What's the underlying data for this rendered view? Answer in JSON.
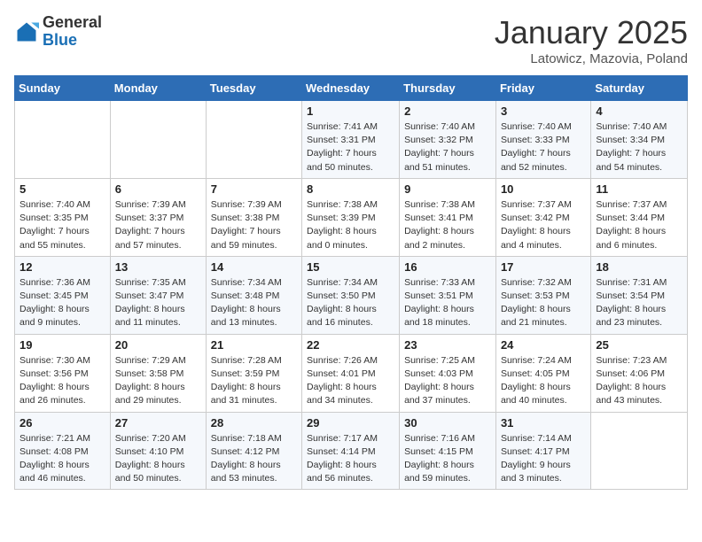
{
  "header": {
    "logo_general": "General",
    "logo_blue": "Blue",
    "title": "January 2025",
    "subtitle": "Latowicz, Mazovia, Poland"
  },
  "days_of_week": [
    "Sunday",
    "Monday",
    "Tuesday",
    "Wednesday",
    "Thursday",
    "Friday",
    "Saturday"
  ],
  "weeks": [
    [
      {
        "day": "",
        "info": ""
      },
      {
        "day": "",
        "info": ""
      },
      {
        "day": "",
        "info": ""
      },
      {
        "day": "1",
        "info": "Sunrise: 7:41 AM\nSunset: 3:31 PM\nDaylight: 7 hours and 50 minutes."
      },
      {
        "day": "2",
        "info": "Sunrise: 7:40 AM\nSunset: 3:32 PM\nDaylight: 7 hours and 51 minutes."
      },
      {
        "day": "3",
        "info": "Sunrise: 7:40 AM\nSunset: 3:33 PM\nDaylight: 7 hours and 52 minutes."
      },
      {
        "day": "4",
        "info": "Sunrise: 7:40 AM\nSunset: 3:34 PM\nDaylight: 7 hours and 54 minutes."
      }
    ],
    [
      {
        "day": "5",
        "info": "Sunrise: 7:40 AM\nSunset: 3:35 PM\nDaylight: 7 hours and 55 minutes."
      },
      {
        "day": "6",
        "info": "Sunrise: 7:39 AM\nSunset: 3:37 PM\nDaylight: 7 hours and 57 minutes."
      },
      {
        "day": "7",
        "info": "Sunrise: 7:39 AM\nSunset: 3:38 PM\nDaylight: 7 hours and 59 minutes."
      },
      {
        "day": "8",
        "info": "Sunrise: 7:38 AM\nSunset: 3:39 PM\nDaylight: 8 hours and 0 minutes."
      },
      {
        "day": "9",
        "info": "Sunrise: 7:38 AM\nSunset: 3:41 PM\nDaylight: 8 hours and 2 minutes."
      },
      {
        "day": "10",
        "info": "Sunrise: 7:37 AM\nSunset: 3:42 PM\nDaylight: 8 hours and 4 minutes."
      },
      {
        "day": "11",
        "info": "Sunrise: 7:37 AM\nSunset: 3:44 PM\nDaylight: 8 hours and 6 minutes."
      }
    ],
    [
      {
        "day": "12",
        "info": "Sunrise: 7:36 AM\nSunset: 3:45 PM\nDaylight: 8 hours and 9 minutes."
      },
      {
        "day": "13",
        "info": "Sunrise: 7:35 AM\nSunset: 3:47 PM\nDaylight: 8 hours and 11 minutes."
      },
      {
        "day": "14",
        "info": "Sunrise: 7:34 AM\nSunset: 3:48 PM\nDaylight: 8 hours and 13 minutes."
      },
      {
        "day": "15",
        "info": "Sunrise: 7:34 AM\nSunset: 3:50 PM\nDaylight: 8 hours and 16 minutes."
      },
      {
        "day": "16",
        "info": "Sunrise: 7:33 AM\nSunset: 3:51 PM\nDaylight: 8 hours and 18 minutes."
      },
      {
        "day": "17",
        "info": "Sunrise: 7:32 AM\nSunset: 3:53 PM\nDaylight: 8 hours and 21 minutes."
      },
      {
        "day": "18",
        "info": "Sunrise: 7:31 AM\nSunset: 3:54 PM\nDaylight: 8 hours and 23 minutes."
      }
    ],
    [
      {
        "day": "19",
        "info": "Sunrise: 7:30 AM\nSunset: 3:56 PM\nDaylight: 8 hours and 26 minutes."
      },
      {
        "day": "20",
        "info": "Sunrise: 7:29 AM\nSunset: 3:58 PM\nDaylight: 8 hours and 29 minutes."
      },
      {
        "day": "21",
        "info": "Sunrise: 7:28 AM\nSunset: 3:59 PM\nDaylight: 8 hours and 31 minutes."
      },
      {
        "day": "22",
        "info": "Sunrise: 7:26 AM\nSunset: 4:01 PM\nDaylight: 8 hours and 34 minutes."
      },
      {
        "day": "23",
        "info": "Sunrise: 7:25 AM\nSunset: 4:03 PM\nDaylight: 8 hours and 37 minutes."
      },
      {
        "day": "24",
        "info": "Sunrise: 7:24 AM\nSunset: 4:05 PM\nDaylight: 8 hours and 40 minutes."
      },
      {
        "day": "25",
        "info": "Sunrise: 7:23 AM\nSunset: 4:06 PM\nDaylight: 8 hours and 43 minutes."
      }
    ],
    [
      {
        "day": "26",
        "info": "Sunrise: 7:21 AM\nSunset: 4:08 PM\nDaylight: 8 hours and 46 minutes."
      },
      {
        "day": "27",
        "info": "Sunrise: 7:20 AM\nSunset: 4:10 PM\nDaylight: 8 hours and 50 minutes."
      },
      {
        "day": "28",
        "info": "Sunrise: 7:18 AM\nSunset: 4:12 PM\nDaylight: 8 hours and 53 minutes."
      },
      {
        "day": "29",
        "info": "Sunrise: 7:17 AM\nSunset: 4:14 PM\nDaylight: 8 hours and 56 minutes."
      },
      {
        "day": "30",
        "info": "Sunrise: 7:16 AM\nSunset: 4:15 PM\nDaylight: 8 hours and 59 minutes."
      },
      {
        "day": "31",
        "info": "Sunrise: 7:14 AM\nSunset: 4:17 PM\nDaylight: 9 hours and 3 minutes."
      },
      {
        "day": "",
        "info": ""
      }
    ]
  ]
}
